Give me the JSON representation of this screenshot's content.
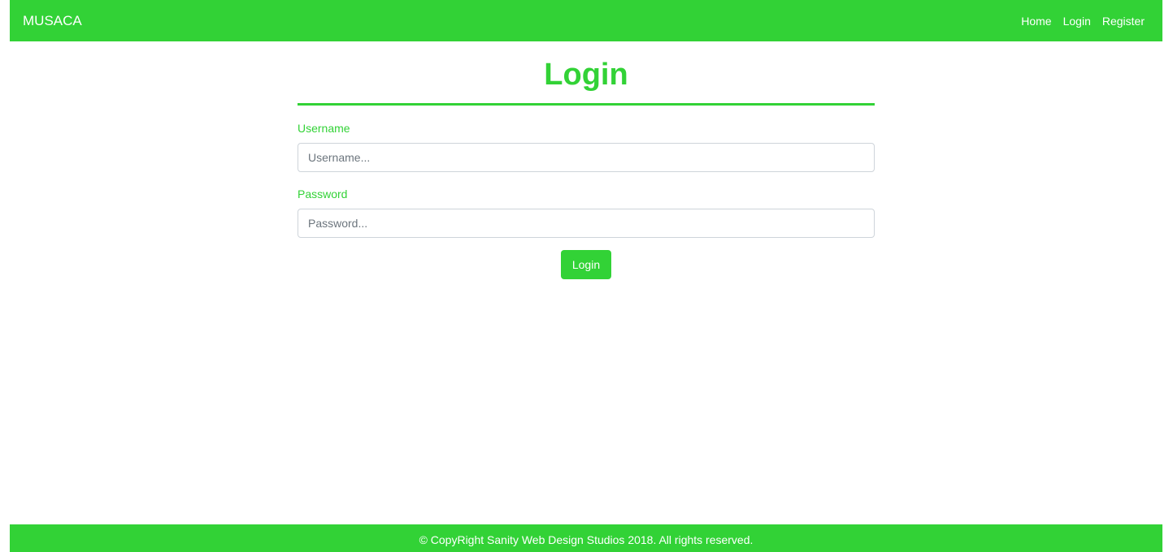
{
  "navbar": {
    "brand": "MUSACA",
    "links": [
      {
        "label": "Home"
      },
      {
        "label": "Login"
      },
      {
        "label": "Register"
      }
    ]
  },
  "form": {
    "title": "Login",
    "username": {
      "label": "Username",
      "placeholder": "Username...",
      "value": ""
    },
    "password": {
      "label": "Password",
      "placeholder": "Password...",
      "value": ""
    },
    "submit_label": "Login"
  },
  "footer": {
    "text": "© CopyRight Sanity Web Design Studios 2018. All rights reserved."
  },
  "colors": {
    "accent": "#32d236",
    "text_on_accent": "#ffffff",
    "input_border": "#ced4da"
  }
}
